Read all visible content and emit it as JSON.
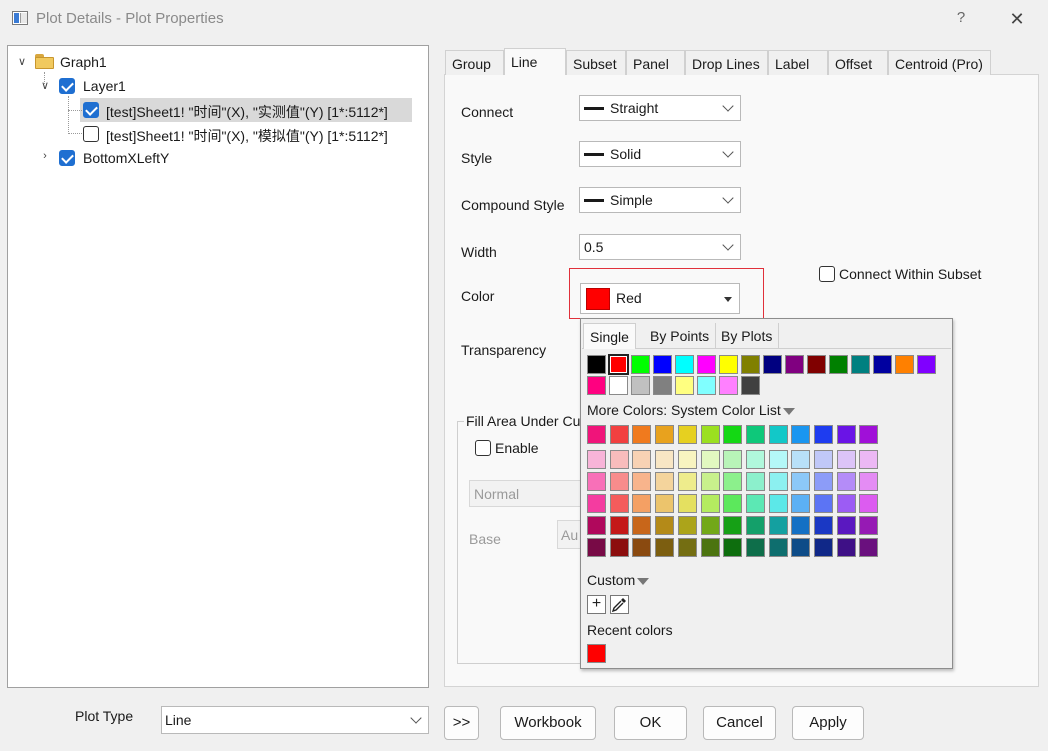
{
  "window": {
    "title": "Plot Details - Plot Properties",
    "help": "?",
    "close": "✕"
  },
  "tree": {
    "graph": "Graph1",
    "layer": "Layer1",
    "plot1": "[test]Sheet1! \"时间\"(X), \"实测值\"(Y) [1*:5112*]",
    "plot2": "[test]Sheet1! \"时间\"(X), \"模拟值\"(Y) [1*:5112*]",
    "layer2": "BottomXLeftY"
  },
  "tabs": [
    "Group",
    "Line",
    "Subset",
    "Panel",
    "Drop Lines",
    "Label",
    "Offset",
    "Centroid (Pro)"
  ],
  "form": {
    "connect_label": "Connect",
    "connect_value": "Straight",
    "style_label": "Style",
    "style_value": "Solid",
    "compound_label": "Compound Style",
    "compound_value": "Simple",
    "width_label": "Width",
    "width_value": "0.5",
    "color_label": "Color",
    "color_value": "Red",
    "transparency_label": "Transparency",
    "connect_within_subset": "Connect Within Subset",
    "fill_group_label": "Fill Area Under Cu",
    "enable_label": "Enable",
    "normal_value": "Normal",
    "base_label": "Base",
    "auto_value": "Au"
  },
  "popup": {
    "tabs": [
      "Single",
      "By Points",
      "By Plots"
    ],
    "more_colors": "More Colors: System Color List",
    "custom": "Custom",
    "recent": "Recent colors",
    "row1": [
      "#000000",
      "#ff0000",
      "#00ff00",
      "#0000ff",
      "#00ffff",
      "#ff00ff",
      "#ffff00",
      "#808000",
      "#000080",
      "#800080",
      "#800000",
      "#008000",
      "#008080",
      "#0000a0",
      "#ff8000",
      "#8000ff"
    ],
    "row2": [
      "#ff0080",
      "#ffffff",
      "#c0c0c0",
      "#808080",
      "#ffff80",
      "#80ffff",
      "#ff80ff",
      "#404040"
    ],
    "system": [
      [
        "#f0147a",
        "#f24040",
        "#f07a1e",
        "#e8a21e",
        "#e6d020",
        "#9be020",
        "#14d814",
        "#0ec87a",
        "#12c8c8",
        "#1a96f0",
        "#1e3cf0",
        "#6a14e6",
        "#a010d8"
      ],
      [
        "#f8b4d8",
        "#f8bcbc",
        "#f8d2b4",
        "#f8e6c4",
        "#f8f4c0",
        "#e2f8c0",
        "#b8f4b8",
        "#b0f8dc",
        "#b4f8f8",
        "#b8e0f8",
        "#c0c8f8",
        "#dcc4f8",
        "#ecb8f4"
      ],
      [
        "#f870b8",
        "#f88c8c",
        "#f8b48c",
        "#f4d49c",
        "#eeec8c",
        "#c8f08c",
        "#8cf08c",
        "#8cf0cc",
        "#8cf0f0",
        "#8cc8f8",
        "#8c9cf8",
        "#b48cf8",
        "#e48cf4"
      ],
      [
        "#f43ca0",
        "#f45c5c",
        "#f4a064",
        "#ecc46c",
        "#e4e060",
        "#b4ec60",
        "#5ce85c",
        "#5ce8b4",
        "#5ce8e8",
        "#5cb0f4",
        "#5c74f4",
        "#9c5cf4",
        "#dc5cf0"
      ],
      [
        "#b0085c",
        "#c41818",
        "#c8661a",
        "#b48a18",
        "#aca41a",
        "#72a818",
        "#16a016",
        "#14a06a",
        "#14a0a0",
        "#1470c4",
        "#1a38c4",
        "#5a18c0",
        "#961ab4"
      ],
      [
        "#780a46",
        "#8c0e0e",
        "#8a4a10",
        "#7c5e10",
        "#746e12",
        "#4c7410",
        "#0e6e0e",
        "#0e6e4a",
        "#0e6e6e",
        "#0e4c88",
        "#102888",
        "#3e1086",
        "#6a107e"
      ]
    ],
    "recent_colors": [
      "#ff0000"
    ]
  },
  "bottom": {
    "plot_type_label": "Plot Type",
    "plot_type_value": "Line",
    "expand": ">>",
    "workbook": "Workbook",
    "ok": "OK",
    "cancel": "Cancel",
    "apply": "Apply"
  }
}
